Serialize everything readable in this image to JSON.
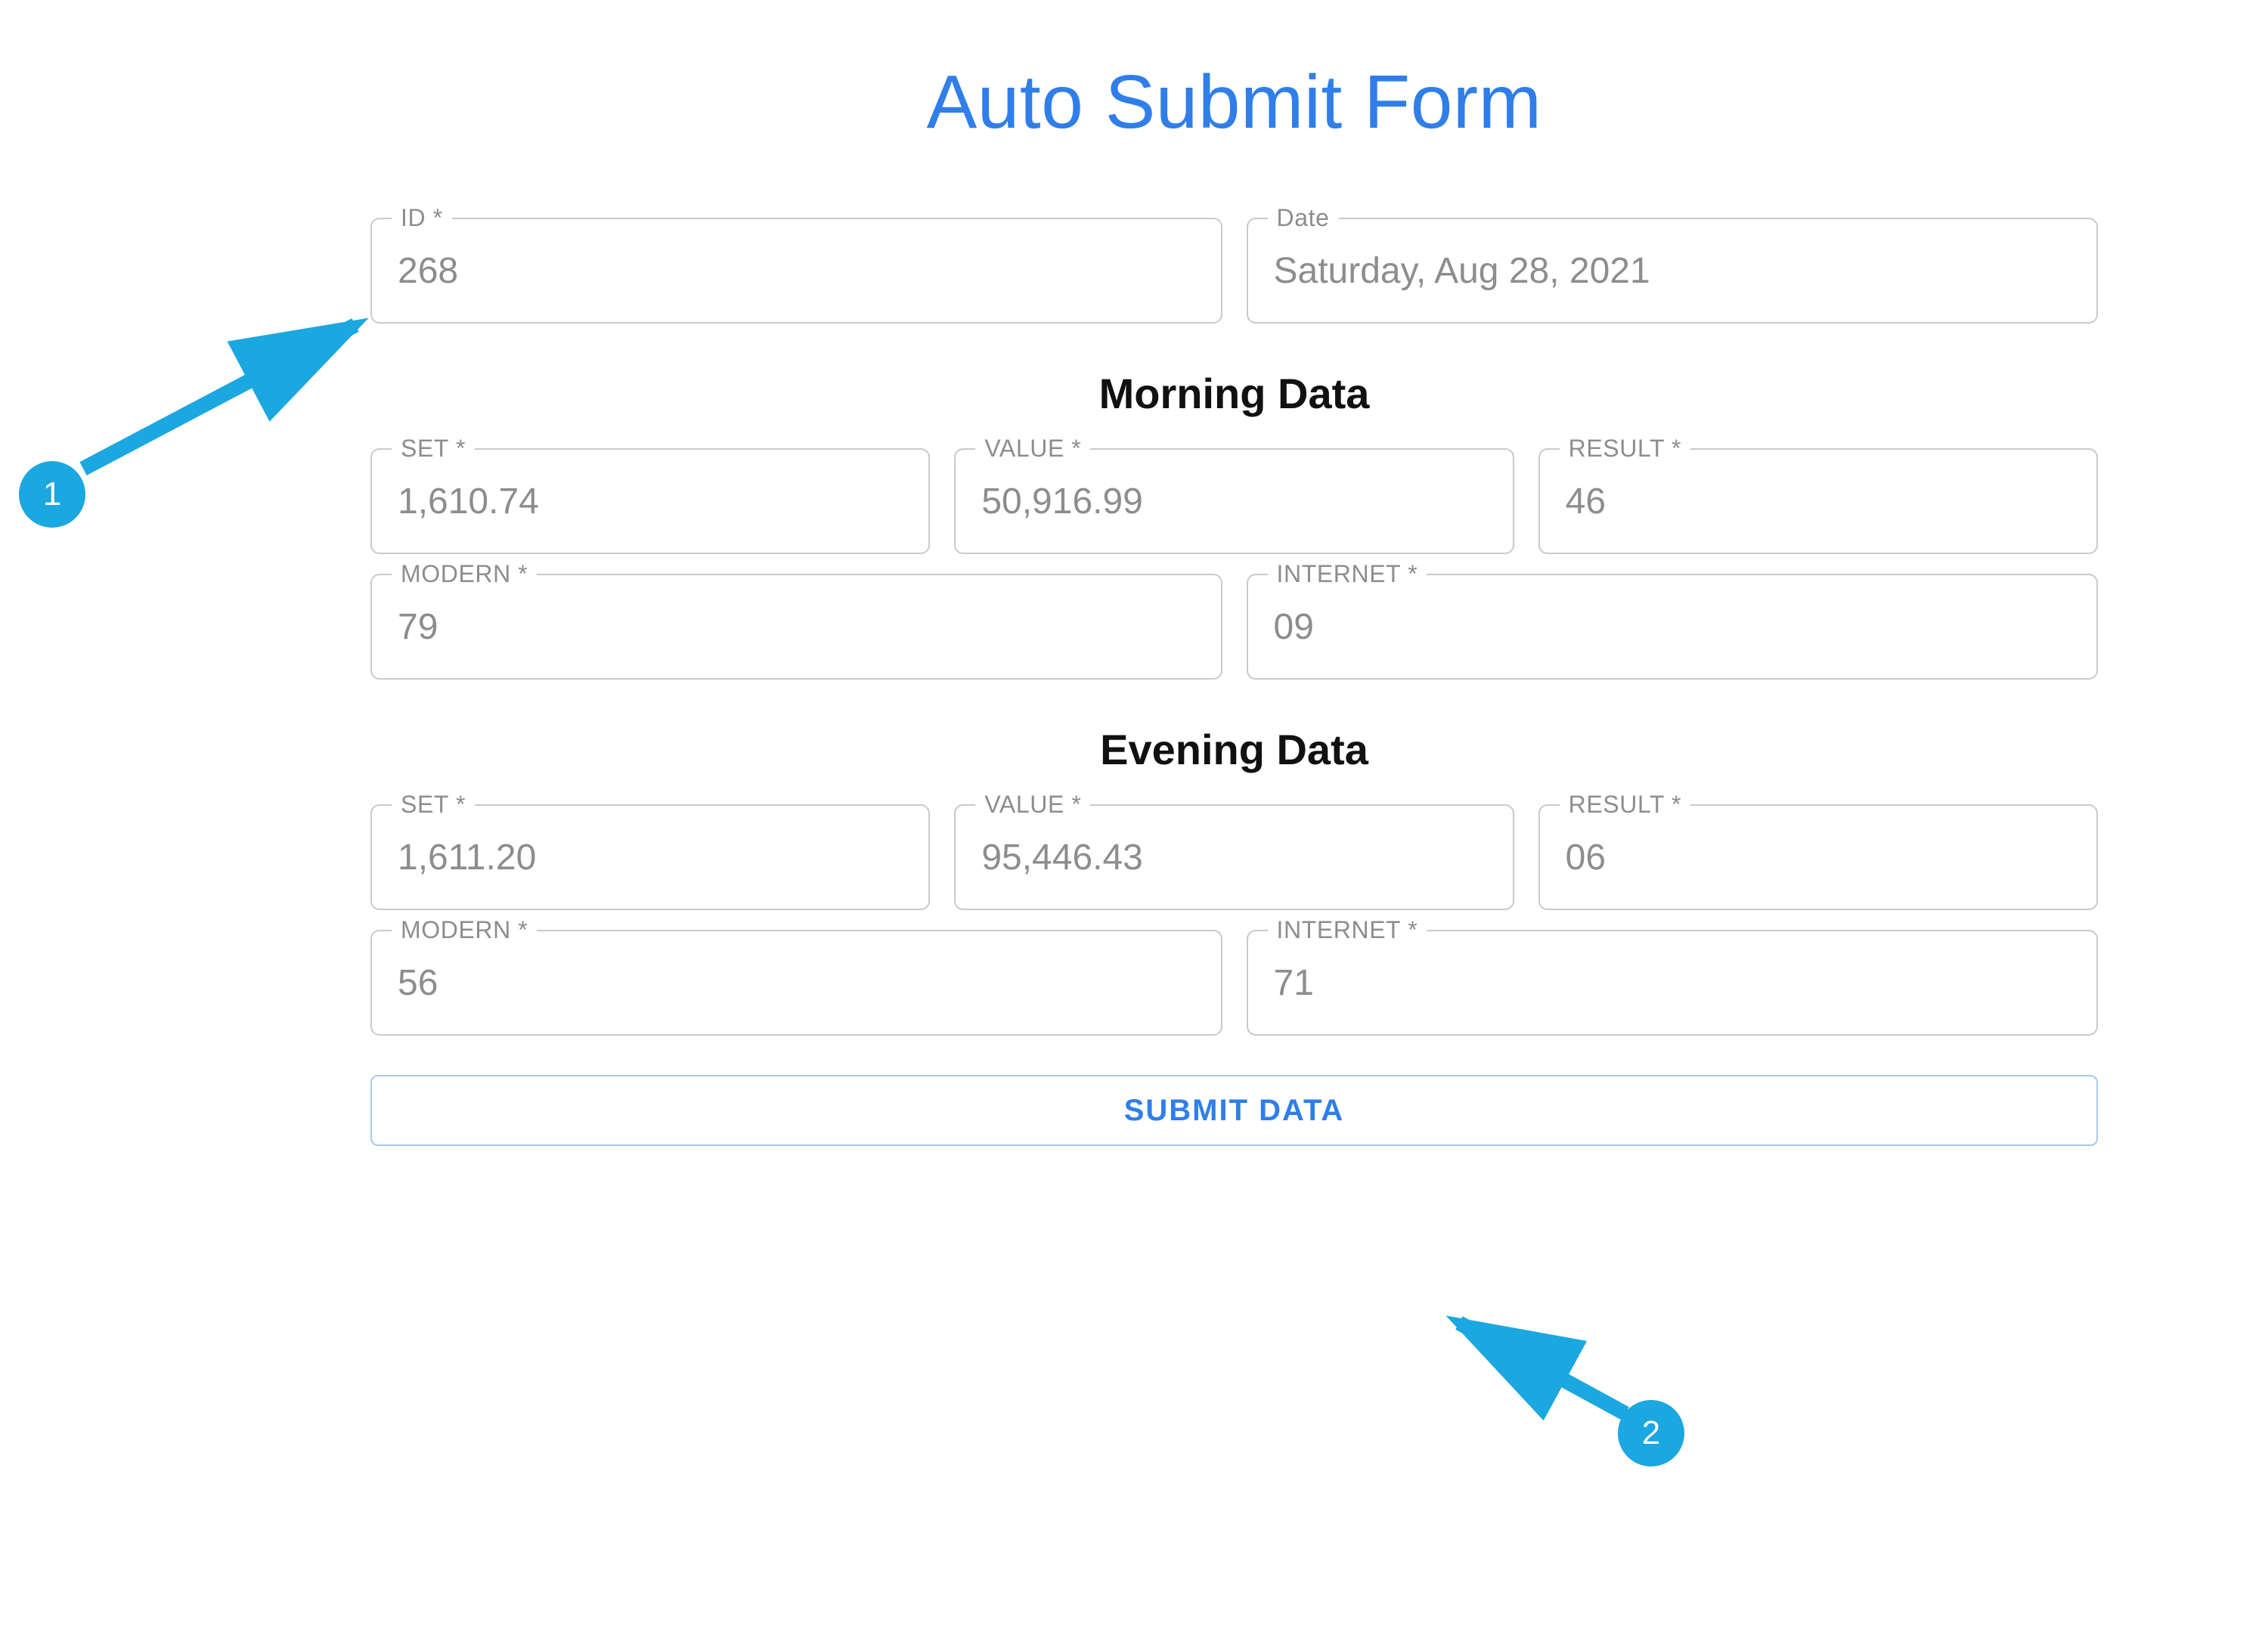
{
  "title": "Auto Submit Form",
  "top": {
    "id_label": "ID *",
    "id_value": "268",
    "date_label": "Date",
    "date_value": "Saturday, Aug 28, 2021"
  },
  "sections": {
    "morning": {
      "title": "Morning Data",
      "set_label": "SET *",
      "set_value": "1,610.74",
      "value_label": "VALUE *",
      "value_value": "50,916.99",
      "result_label": "RESULT *",
      "result_value": "46",
      "modern_label": "MODERN *",
      "modern_value": "79",
      "internet_label": "INTERNET *",
      "internet_value": "09"
    },
    "evening": {
      "title": "Evening Data",
      "set_label": "SET *",
      "set_value": "1,611.20",
      "value_label": "VALUE *",
      "value_value": "95,446.43",
      "result_label": "RESULT *",
      "result_value": "06",
      "modern_label": "MODERN *",
      "modern_value": "56",
      "internet_label": "INTERNET *",
      "internet_value": "71"
    }
  },
  "submit_label": "SUBMIT DATA",
  "callouts": {
    "one": "1",
    "two": "2"
  },
  "colors": {
    "accent": "#2f7eea",
    "callout": "#1ba7e0",
    "arrow": "#1ba7e0"
  }
}
